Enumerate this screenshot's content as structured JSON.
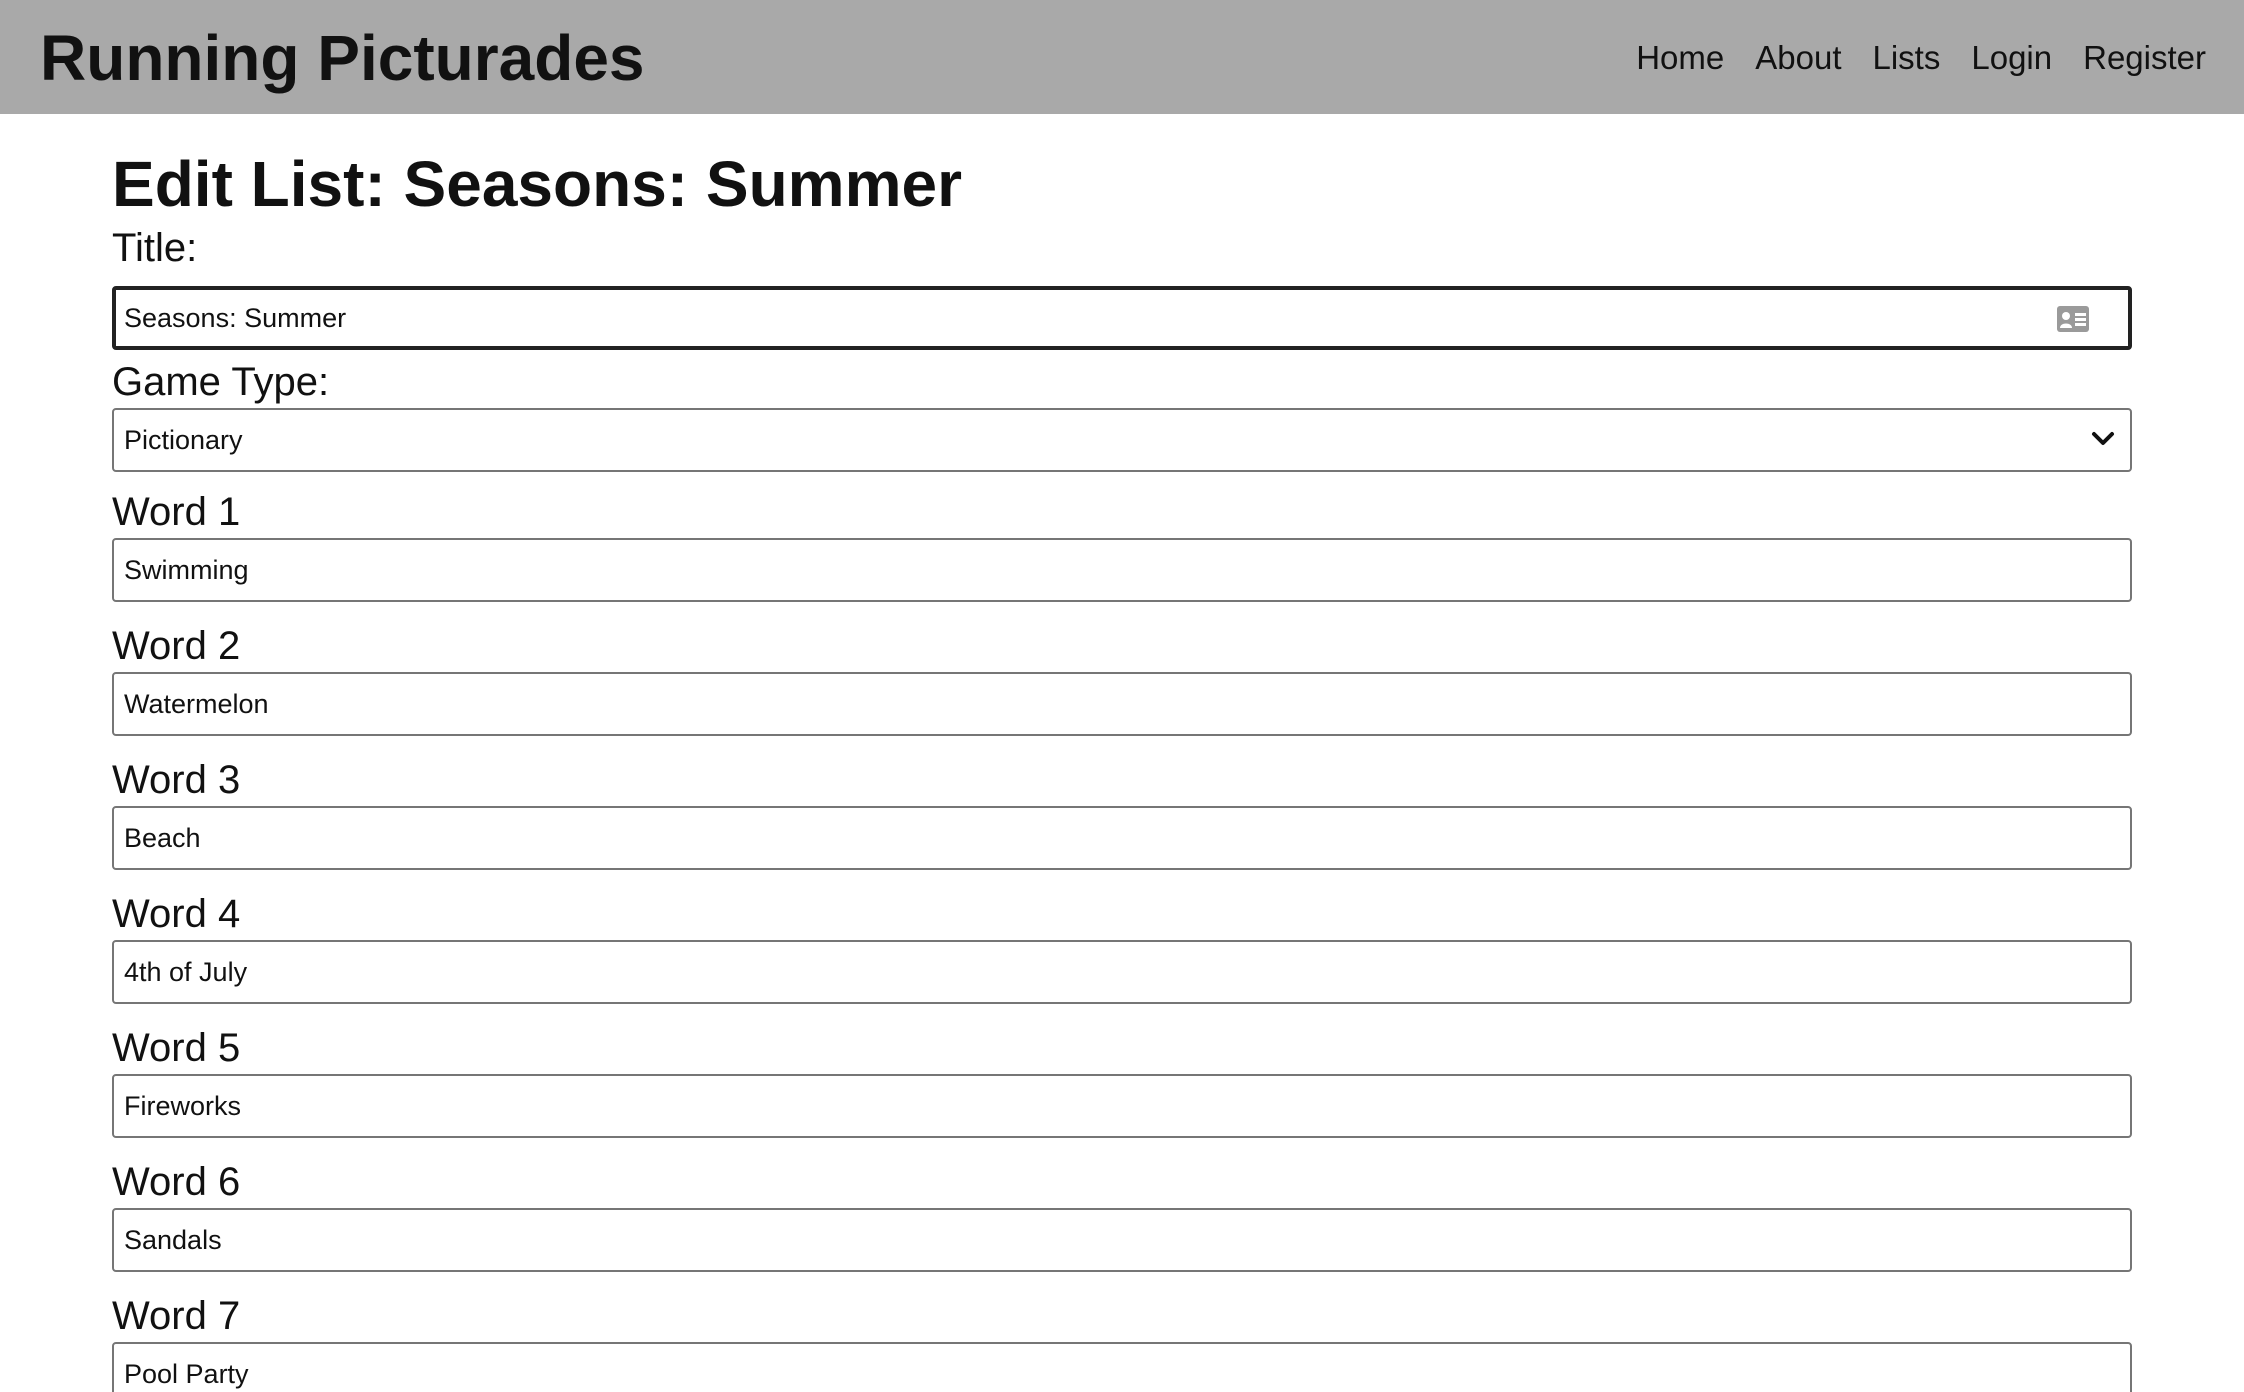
{
  "navbar": {
    "brand": "Running Picturades",
    "links": [
      "Home",
      "About",
      "Lists",
      "Login",
      "Register"
    ]
  },
  "page": {
    "title": "Edit List: Seasons: Summer"
  },
  "form": {
    "title_label": "Title:",
    "title_value": "Seasons: Summer",
    "game_type_label": "Game Type:",
    "game_type_value": "Pictionary",
    "words": [
      {
        "label": "Word 1",
        "value": "Swimming"
      },
      {
        "label": "Word 2",
        "value": "Watermelon"
      },
      {
        "label": "Word 3",
        "value": "Beach"
      },
      {
        "label": "Word 4",
        "value": "4th of July"
      },
      {
        "label": "Word 5",
        "value": "Fireworks"
      },
      {
        "label": "Word 6",
        "value": "Sandals"
      },
      {
        "label": "Word 7",
        "value": "Pool Party"
      }
    ]
  },
  "icons": {
    "title_field_icon": "contact-card-icon",
    "select_icon": "chevron-down-icon"
  },
  "colors": {
    "navbar_bg": "#a9a9a9",
    "page_bg": "#ffffff",
    "text": "#111111",
    "input_border": "#767676",
    "focused_border": "#222222"
  }
}
